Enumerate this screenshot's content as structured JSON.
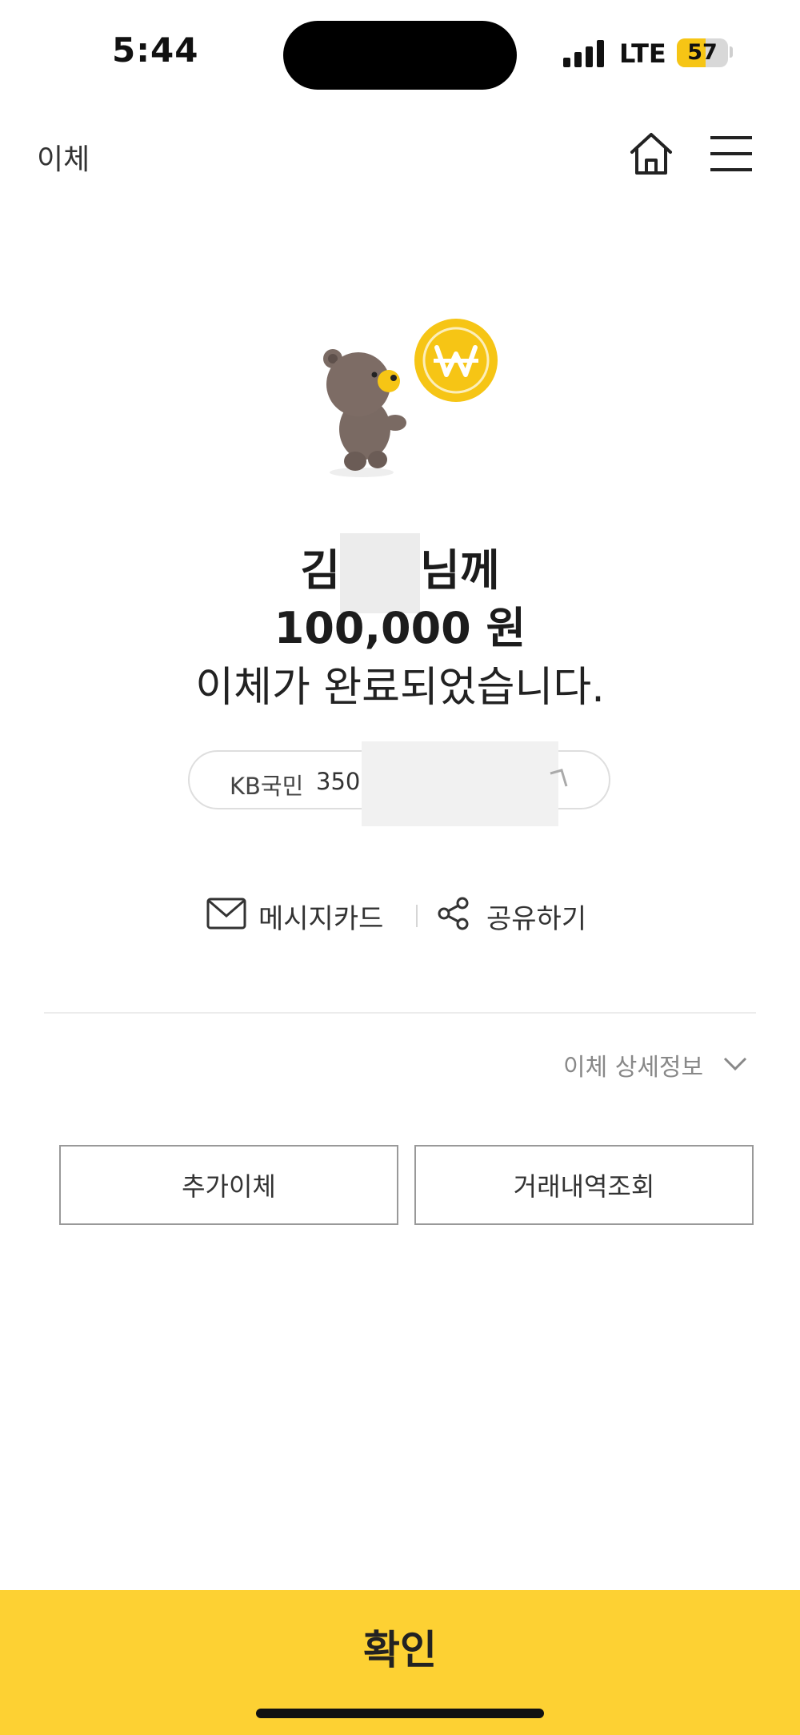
{
  "status_bar": {
    "time": "5:44",
    "network": "LTE",
    "battery": "57",
    "battery_level": 0.57
  },
  "header": {
    "title": "이체",
    "home_icon": "home-icon",
    "menu_icon": "menu-icon"
  },
  "result": {
    "recipient_prefix": "김",
    "recipient_suffix": "님께",
    "amount": "100,000 원",
    "message": "이체가 완료되었습니다."
  },
  "account": {
    "bank": "KB국민",
    "number_visible": "350"
  },
  "actions": {
    "message_card": "메시지카드",
    "share": "공유하기"
  },
  "details": {
    "label": "이체 상세정보"
  },
  "buttons": {
    "additional_transfer": "추가이체",
    "history": "거래내역조회"
  },
  "confirm": {
    "label": "확인"
  },
  "colors": {
    "brand_yellow": "#fdd133",
    "coin_yellow": "#f6c515"
  }
}
